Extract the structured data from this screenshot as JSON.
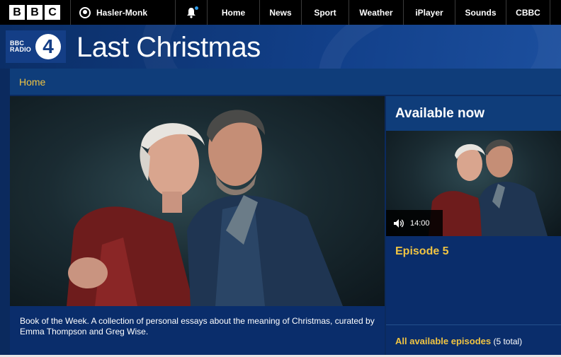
{
  "topbar": {
    "logo_letters": [
      "B",
      "B",
      "C"
    ],
    "account_name": "Hasler-Monk",
    "nav": [
      {
        "label": "Home",
        "w": 74
      },
      {
        "label": "News",
        "w": 59
      },
      {
        "label": "Sport",
        "w": 67
      },
      {
        "label": "Weather",
        "w": 77
      },
      {
        "label": "iPlayer",
        "w": 73
      },
      {
        "label": "Sounds",
        "w": 72
      },
      {
        "label": "CBBC",
        "w": 62
      }
    ]
  },
  "header": {
    "station_logo_text": "BBC RADIO",
    "station_number": "4",
    "programme_title": "Last Christmas"
  },
  "breadcrumb": {
    "home": "Home"
  },
  "main": {
    "image_alt": "Emma Thompson and Greg Wise",
    "caption": "Book of the Week. A collection of personal essays about the meaning of Christmas, curated by Emma Thompson and Greg Wise."
  },
  "sidebar": {
    "heading": "Available now",
    "episode_duration": "14:00",
    "episode_title": "Episode 5",
    "all_episodes_link": "All available episodes",
    "all_episodes_count": "(5 total)"
  },
  "colors": {
    "accent_yellow": "#f0c442",
    "navy": "#0a2d6b",
    "topbar": "#000000"
  }
}
